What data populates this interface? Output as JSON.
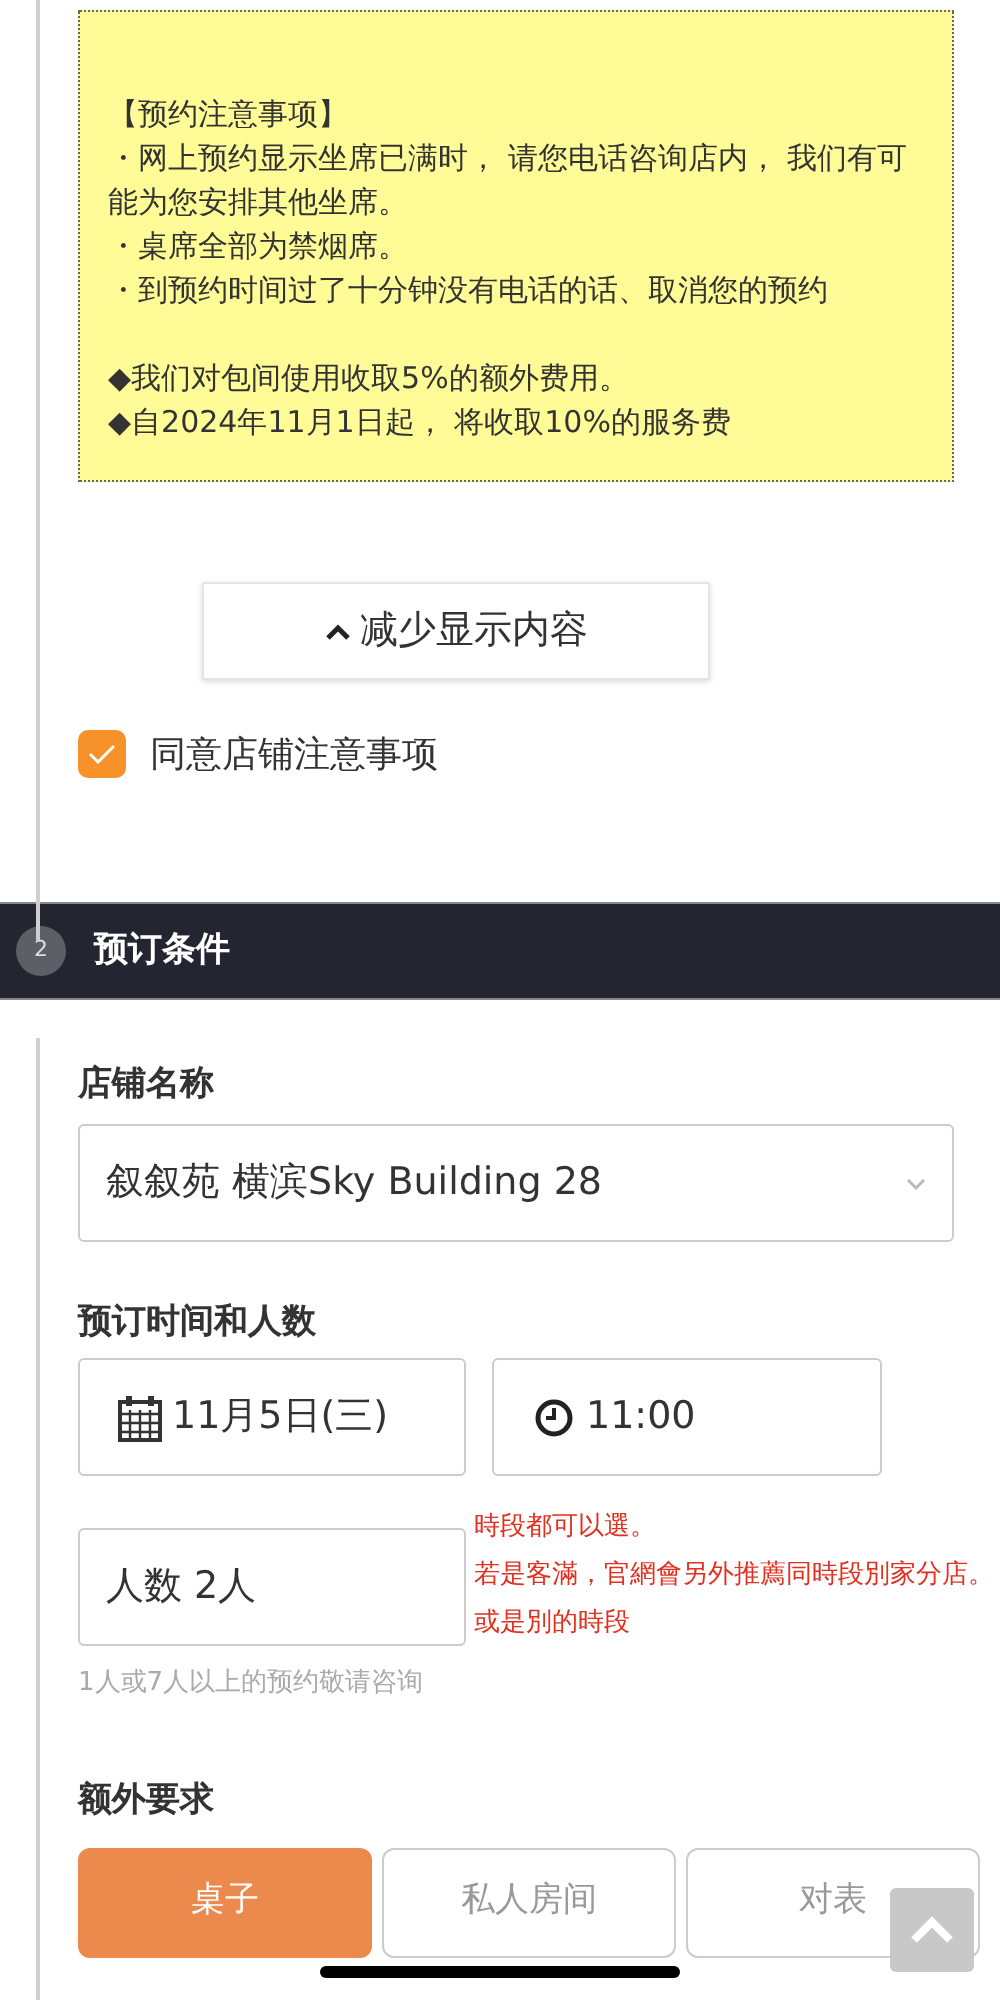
{
  "notice": {
    "title": "【预约注意事项】",
    "lines": [
      "・网上预约显示坐席已满时， 请您电话咨询店内， 我们有可能为您安排其他坐席。",
      "・桌席全部为禁烟席。",
      "・到预约时间过了十分钟没有电话的话、取消您的预约"
    ],
    "fees": [
      "◆我们对包间使用收取5%的额外费用。",
      "◆自2024年11月1日起， 将收取10%的服务费"
    ]
  },
  "collapse_button": {
    "label": "减少显示内容"
  },
  "agree": {
    "label": "同意店铺注意事项",
    "checked": true
  },
  "section": {
    "number": "2",
    "title": "预订条件"
  },
  "store": {
    "label": "店铺名称",
    "value": "叙叙苑 横滨Sky Building 28"
  },
  "datetime": {
    "label": "预订时间和人数",
    "date": "11月5日(三)",
    "time": "11:00",
    "people": "人数 2人",
    "hint": "1人或7人以上的预约敬请咨询"
  },
  "annotation": [
    "時段都可以選。",
    "若是客滿，官網會另外推薦同時段別家分店。",
    "或是別的時段"
  ],
  "extra": {
    "label": "额外要求",
    "options": [
      {
        "label": "桌子",
        "selected": true
      },
      {
        "label": "私人房间",
        "selected": false
      },
      {
        "label": "对表",
        "selected": false
      }
    ]
  }
}
